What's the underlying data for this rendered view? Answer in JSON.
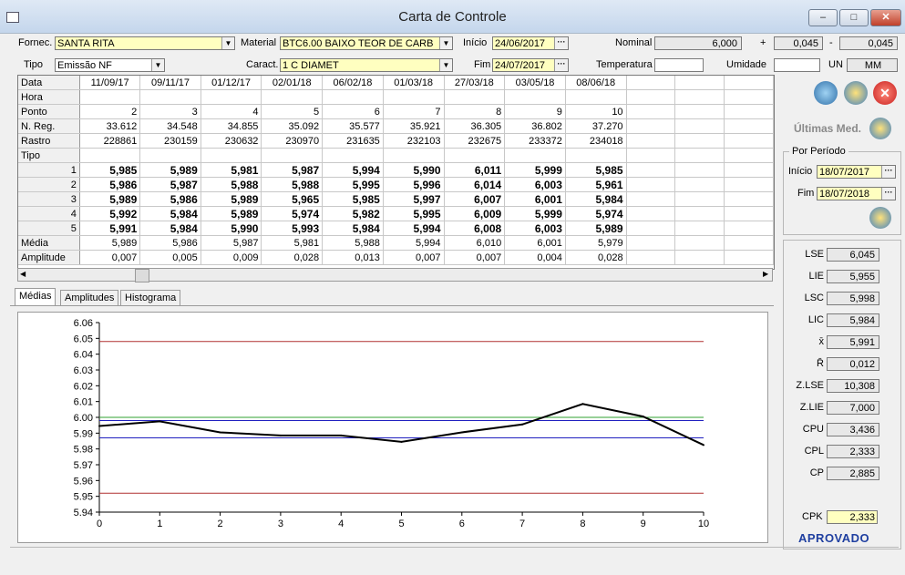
{
  "window": {
    "title": "Carta de Controle",
    "minimize": "–",
    "maximize": "□",
    "close": "✕"
  },
  "form": {
    "fornec_label": "Fornec.",
    "fornec_value": "SANTA RITA",
    "material_label": "Material",
    "material_value": "BTC6.00   BAIXO TEOR DE CARB",
    "inicio_label": "Início",
    "inicio_value": "24/06/2017",
    "nominal_label": "Nominal",
    "nominal_value": "6,000",
    "plus_sign": "+",
    "plus_value": "0,045",
    "minus_sign": "-",
    "minus_value": "0,045",
    "tipo_label": "Tipo",
    "tipo_value": "Emissão NF",
    "caract_label": "Caract.",
    "caract_value": "1   C DIAMET",
    "fim_label": "Fim",
    "fim_value": "24/07/2017",
    "temperatura_label": "Temperatura",
    "temperatura_value": "",
    "umidade_label": "Umidade",
    "umidade_value": "",
    "un_label": "UN",
    "un_value": "MM",
    "dots": "···"
  },
  "grid": {
    "row_labels": [
      "Data",
      "Hora",
      "Ponto",
      "N. Reg.",
      "Rastro",
      "Tipo",
      "1",
      "2",
      "3",
      "4",
      "5",
      "Média",
      "Amplitude"
    ],
    "columns": [
      {
        "data": "11/09/17",
        "hora": "",
        "ponto": "2",
        "nreg": "33.612",
        "rastro": "228861",
        "tipo": "",
        "v": [
          "5,985",
          "5,986",
          "5,989",
          "5,992",
          "5,991"
        ],
        "media": "5,989",
        "amp": "0,007"
      },
      {
        "data": "09/11/17",
        "hora": "",
        "ponto": "3",
        "nreg": "34.548",
        "rastro": "230159",
        "tipo": "",
        "v": [
          "5,989",
          "5,987",
          "5,986",
          "5,984",
          "5,984"
        ],
        "media": "5,986",
        "amp": "0,005"
      },
      {
        "data": "01/12/17",
        "hora": "",
        "ponto": "4",
        "nreg": "34.855",
        "rastro": "230632",
        "tipo": "",
        "v": [
          "5,981",
          "5,988",
          "5,989",
          "5,989",
          "5,990"
        ],
        "media": "5,987",
        "amp": "0,009"
      },
      {
        "data": "02/01/18",
        "hora": "",
        "ponto": "5",
        "nreg": "35.092",
        "rastro": "230970",
        "tipo": "",
        "v": [
          "5,987",
          "5,988",
          "5,965",
          "5,974",
          "5,993"
        ],
        "media": "5,981",
        "amp": "0,028"
      },
      {
        "data": "06/02/18",
        "hora": "",
        "ponto": "6",
        "nreg": "35.577",
        "rastro": "231635",
        "tipo": "",
        "v": [
          "5,994",
          "5,995",
          "5,985",
          "5,982",
          "5,984"
        ],
        "media": "5,988",
        "amp": "0,013"
      },
      {
        "data": "01/03/18",
        "hora": "",
        "ponto": "7",
        "nreg": "35.921",
        "rastro": "232103",
        "tipo": "",
        "v": [
          "5,990",
          "5,996",
          "5,997",
          "5,995",
          "5,994"
        ],
        "media": "5,994",
        "amp": "0,007"
      },
      {
        "data": "27/03/18",
        "hora": "",
        "ponto": "8",
        "nreg": "36.305",
        "rastro": "232675",
        "tipo": "",
        "v": [
          "6,011",
          "6,014",
          "6,007",
          "6,009",
          "6,008"
        ],
        "media": "6,010",
        "amp": "0,007"
      },
      {
        "data": "03/05/18",
        "hora": "",
        "ponto": "9",
        "nreg": "36.802",
        "rastro": "233372",
        "tipo": "",
        "v": [
          "5,999",
          "6,003",
          "6,001",
          "5,999",
          "6,003"
        ],
        "media": "6,001",
        "amp": "0,004"
      },
      {
        "data": "08/06/18",
        "hora": "",
        "ponto": "10",
        "nreg": "37.270",
        "rastro": "234018",
        "tipo": "",
        "v": [
          "5,985",
          "5,961",
          "5,984",
          "5,974",
          "5,989"
        ],
        "media": "5,979",
        "amp": "0,028"
      }
    ],
    "empty_columns": 3
  },
  "tabs": [
    "Médias",
    "Amplitudes",
    "Histograma"
  ],
  "side": {
    "ultimas_label": "Últimas Med.",
    "periodo_title": "Por Período",
    "periodo_inicio_label": "Início",
    "periodo_inicio_value": "18/07/2017",
    "periodo_fim_label": "Fim",
    "periodo_fim_value": "18/07/2018",
    "stats": [
      {
        "label": "LSE",
        "value": "6,045"
      },
      {
        "label": "LIE",
        "value": "5,955"
      },
      {
        "label": "LSC",
        "value": "5,998"
      },
      {
        "label": "LIC",
        "value": "5,984"
      },
      {
        "label": "x̄",
        "value": "5,991"
      },
      {
        "label": "R̄",
        "value": "0,012"
      },
      {
        "label": "Z.LSE",
        "value": "10,308"
      },
      {
        "label": "Z.LIE",
        "value": "7,000"
      },
      {
        "label": "CPU",
        "value": "3,436"
      },
      {
        "label": "CPL",
        "value": "2,333"
      },
      {
        "label": "CP",
        "value": "2,885"
      }
    ],
    "cpk_label": "CPK",
    "cpk_value": "2,333",
    "status": "APROVADO",
    "colors": {
      "status": "#1f3fa0",
      "cpk_bg": "#ffffc0"
    }
  },
  "chart_data": {
    "type": "line",
    "x": [
      0,
      1,
      2,
      3,
      4,
      5,
      6,
      7,
      8,
      9,
      10
    ],
    "series": [
      {
        "values": [
          5.9945,
          5.9975,
          5.9905,
          5.9885,
          5.9885,
          5.9845,
          5.9905,
          5.9955,
          6.0085,
          6.0005,
          5.9825
        ],
        "color": "#000000"
      }
    ],
    "reference_lines": [
      {
        "y": 6.048,
        "color": "#b03030"
      },
      {
        "y": 5.952,
        "color": "#b03030"
      },
      {
        "y": 6.0,
        "color": "#30a030"
      },
      {
        "y": 5.998,
        "color": "#2020c0"
      },
      {
        "y": 5.987,
        "color": "#2020c0"
      }
    ],
    "xlim": [
      0,
      10
    ],
    "ylim": [
      5.94,
      6.06
    ],
    "yticks": [
      "6.06",
      "6.05",
      "6.04",
      "6.03",
      "6.02",
      "6.01",
      "6.00",
      "5.99",
      "5.98",
      "5.97",
      "5.96",
      "5.95",
      "5.94"
    ],
    "xticks": [
      "0",
      "1",
      "2",
      "3",
      "4",
      "5",
      "6",
      "7",
      "8",
      "9",
      "10"
    ]
  }
}
